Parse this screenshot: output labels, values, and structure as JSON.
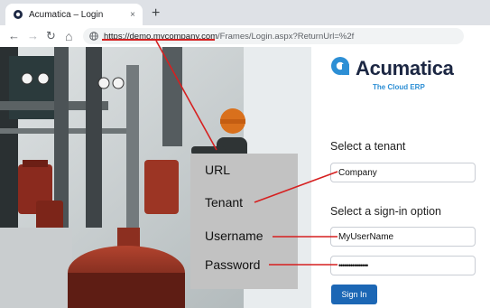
{
  "browser": {
    "tab_title": "Acumatica – Login",
    "tab_close": "×",
    "new_tab": "+",
    "nav": {
      "back": "←",
      "forward": "→",
      "reload": "↻",
      "home": "⌂"
    },
    "url_host": "https://demo.mycompany.com",
    "url_path": "/Frames/Login.aspx?ReturnUrl=%2f"
  },
  "login": {
    "brand": "Acumatica",
    "tagline": "The Cloud ERP",
    "tenant_heading": "Select a tenant",
    "tenant_value": "Company",
    "signin_heading": "Select a sign-in option",
    "username_value": "MyUserName",
    "password_value": "•••••••••••••••",
    "signin_button": "Sign In"
  },
  "callouts": {
    "url": "URL",
    "tenant": "Tenant",
    "username": "Username",
    "password": "Password"
  },
  "colors": {
    "accent_red": "#d62020",
    "brand_navy": "#1c2743",
    "brand_blue": "#2d8fd5",
    "button_blue": "#1c67b5"
  }
}
